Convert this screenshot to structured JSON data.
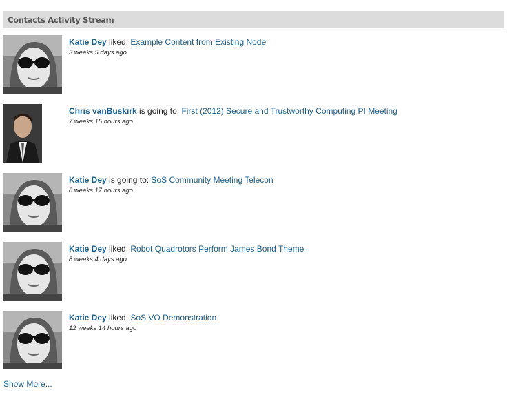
{
  "panel": {
    "title": "Contacts Activity Stream"
  },
  "items": [
    {
      "actor": "Katie Dey",
      "verb": " liked: ",
      "target": "Example Content from Existing Node",
      "time": "3 weeks 5 days ago",
      "avatar_icon": "katie-avatar-icon"
    },
    {
      "actor": "Chris vanBuskirk",
      "verb": " is going to: ",
      "target": "First (2012) Secure and Trustworthy Computing PI Meeting",
      "time": "7 weeks 15 hours ago",
      "avatar_icon": "chris-avatar-icon"
    },
    {
      "actor": "Katie Dey",
      "verb": " is going to: ",
      "target": "SoS Community Meeting Telecon",
      "time": "8 weeks 17 hours ago",
      "avatar_icon": "katie-avatar-icon"
    },
    {
      "actor": "Katie Dey",
      "verb": " liked: ",
      "target": "Robot Quadrotors Perform James Bond Theme",
      "time": "8 weeks 4 days ago",
      "avatar_icon": "katie-avatar-icon"
    },
    {
      "actor": "Katie Dey",
      "verb": " liked: ",
      "target": "SoS VO Demonstration",
      "time": "12 weeks 14 hours ago",
      "avatar_icon": "katie-avatar-icon"
    }
  ],
  "footer": {
    "show_more": "Show More..."
  }
}
